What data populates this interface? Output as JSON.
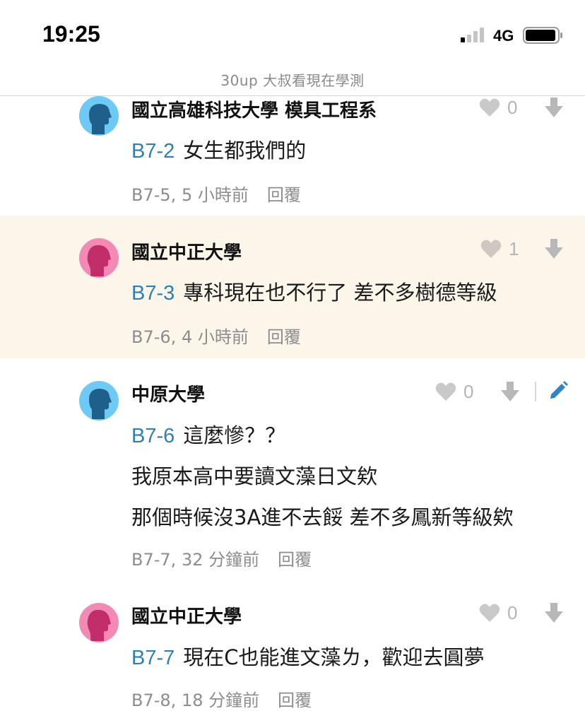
{
  "status_bar": {
    "time": "19:25",
    "network": "4G"
  },
  "header": {
    "title": "30up 大叔看現在學測"
  },
  "comments": [
    {
      "author": "國立高雄科技大學 模具工程系",
      "floor_ref": "B7-2",
      "lines": [
        "女生都我們的"
      ],
      "floor": "B7-5",
      "time": "5 小時前",
      "reply_label": "回覆",
      "likes": "0"
    },
    {
      "author": "國立中正大學",
      "floor_ref": "B7-3",
      "lines": [
        "專科現在也不行了 差不多樹德等級"
      ],
      "floor": "B7-6",
      "time": "4 小時前",
      "reply_label": "回覆",
      "likes": "1"
    },
    {
      "author": "中原大學",
      "floor_ref": "B7-6",
      "lines": [
        "這麼慘？？",
        "我原本高中要讀文藻日文欸",
        "那個時候沒3A進不去餒 差不多鳳新等級欸"
      ],
      "floor": "B7-7",
      "time": "32 分鐘前",
      "reply_label": "回覆",
      "likes": "0"
    },
    {
      "author": "國立中正大學",
      "floor_ref": "B7-7",
      "lines": [
        "現在C也能進文藻ㄌ，歡迎去圓夢"
      ],
      "floor": "B7-8",
      "time": "18 分鐘前",
      "reply_label": "回覆",
      "likes": "0"
    }
  ],
  "colors": {
    "accent": "#2f7fb5",
    "highlight_bg": "#fbf5ea",
    "avatar_male": "#6ec9f4",
    "avatar_female": "#f38ab5"
  },
  "icons": [
    "signal-icon",
    "battery-icon",
    "male-avatar-icon",
    "female-avatar-icon",
    "heart-icon",
    "arrow-down-icon",
    "pencil-icon"
  ]
}
